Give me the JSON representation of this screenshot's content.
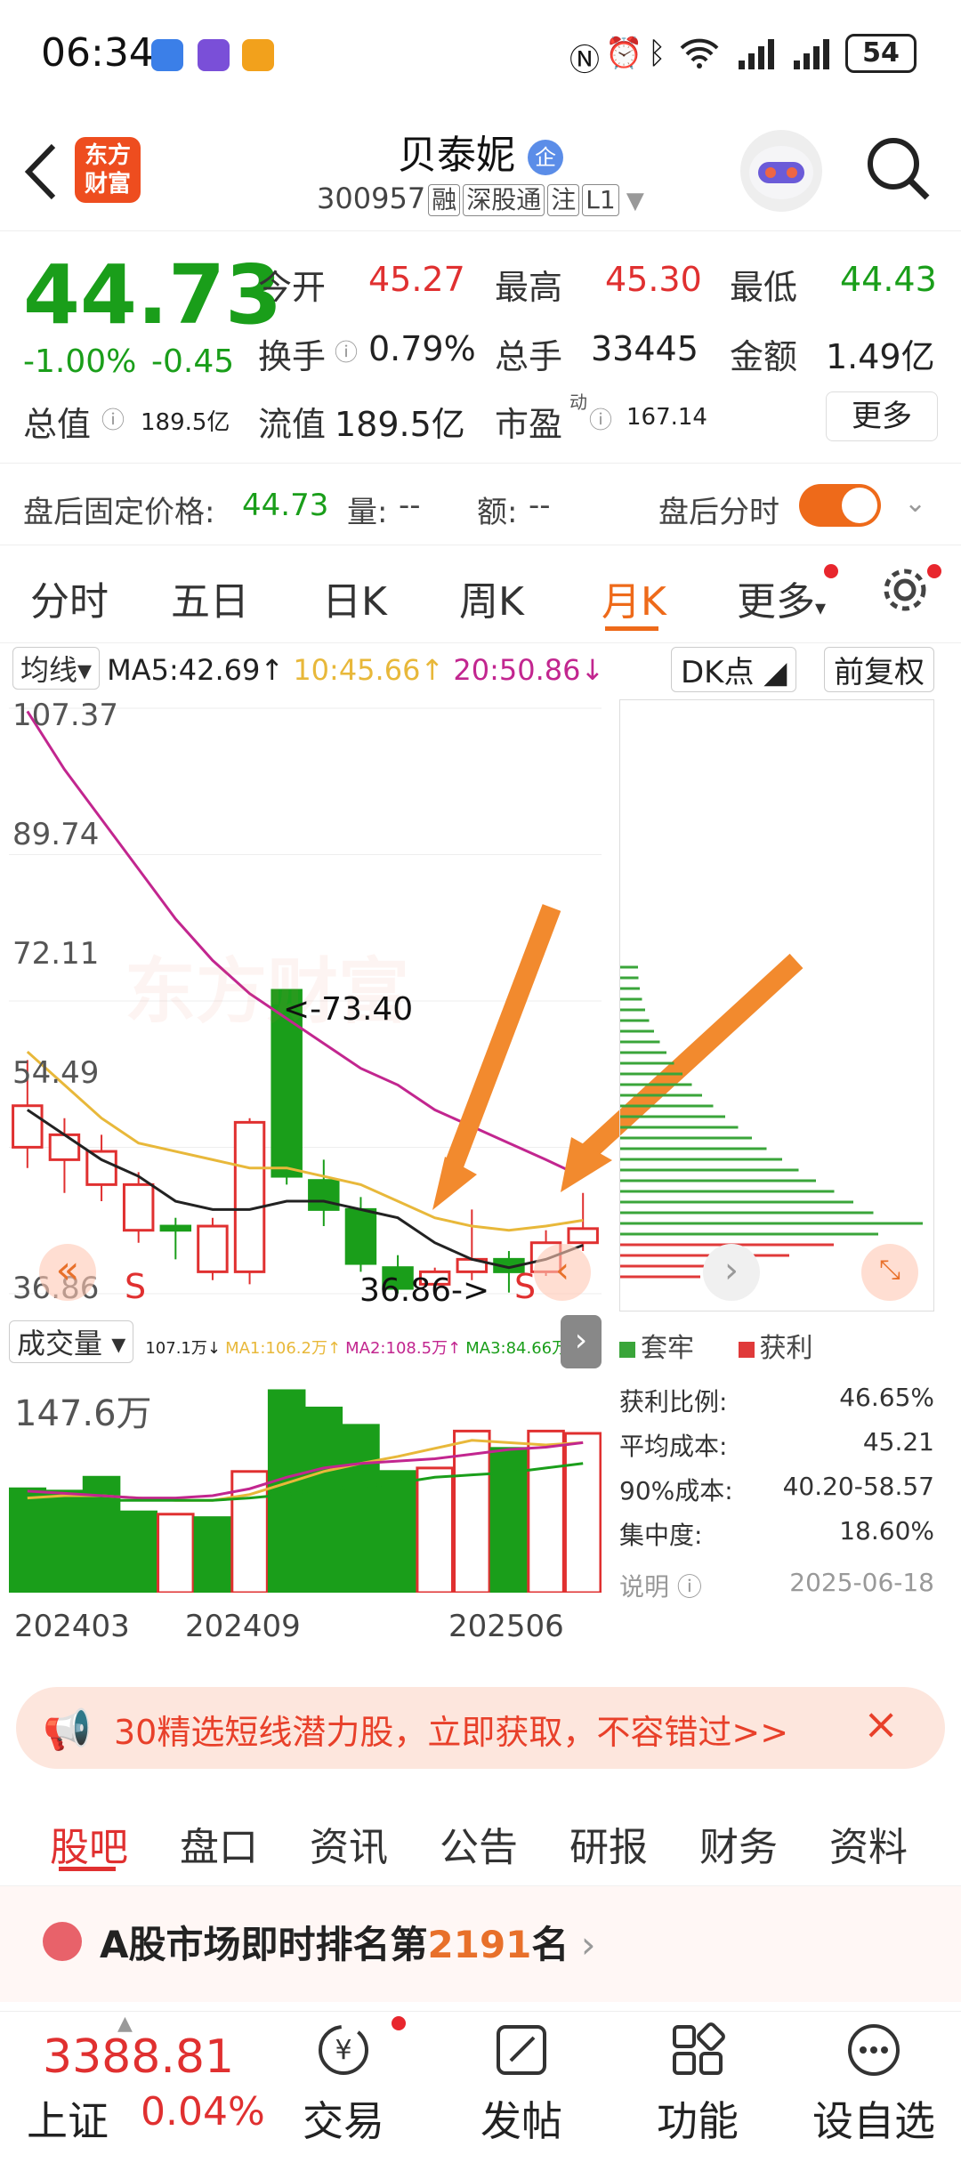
{
  "status": {
    "time": "06:34",
    "battery": "54"
  },
  "header": {
    "back_icon": "back-arrow-icon",
    "logo_text": "东方财富",
    "stock_name": "贝泰妮",
    "enterprise_badge": "企",
    "stock_code": "300957",
    "tags": [
      "融",
      "深股通",
      "注",
      "L1"
    ]
  },
  "quote": {
    "price": "44.73",
    "change_pct": "-1.00%",
    "change_amt": "-0.45",
    "open_label": "今开",
    "open": "45.27",
    "high_label": "最高",
    "high": "45.30",
    "low_label": "最低",
    "low": "44.43",
    "turnover_label": "换手",
    "turnover": "0.79%",
    "volume_label": "总手",
    "volume": "33445",
    "amount_label": "金额",
    "amount": "1.49亿",
    "mktcap_label": "总值",
    "mktcap": "189.5亿",
    "float_label": "流值",
    "float": "189.5亿",
    "pe_label": "市盈",
    "pe_super": "动",
    "pe": "167.14",
    "more_button": "更多"
  },
  "after_hours": {
    "label": "盘后固定价格:",
    "price": "44.73",
    "vol_label": "量:",
    "vol": "--",
    "amt_label": "额:",
    "amt": "--",
    "timeshare_label": "盘后分时"
  },
  "tabs": [
    "分时",
    "五日",
    "日K",
    "周K",
    "月K",
    "更多"
  ],
  "active_tab": "月K",
  "ma": {
    "selector": "均线",
    "ma5": "MA5:42.69",
    "ma10": "10:45.66",
    "ma20": "20:50.86",
    "dk_button": "DK点",
    "adjust_button": "前复权"
  },
  "chart_data": {
    "type": "candlestick",
    "y_labels": [
      "107.37",
      "89.74",
      "72.11",
      "54.49",
      "36.86"
    ],
    "ylim": [
      36.86,
      107.37
    ],
    "annotations": [
      "<-73.40",
      "36.86->"
    ],
    "signal_labels": [
      "S",
      "S"
    ],
    "candles": [
      {
        "o": 54.5,
        "c": 59.5,
        "h": 65.0,
        "l": 52.0
      },
      {
        "o": 53.0,
        "c": 56.0,
        "h": 58.0,
        "l": 49.0
      },
      {
        "o": 50.0,
        "c": 54.0,
        "h": 56.0,
        "l": 48.0
      },
      {
        "o": 44.5,
        "c": 50.0,
        "h": 51.5,
        "l": 43.0
      },
      {
        "o": 45.0,
        "c": 44.5,
        "h": 46.0,
        "l": 41.0
      },
      {
        "o": 39.5,
        "c": 45.0,
        "h": 46.0,
        "l": 38.5
      },
      {
        "o": 39.5,
        "c": 57.5,
        "h": 58.0,
        "l": 38.0
      },
      {
        "o": 73.4,
        "c": 51.0,
        "h": 73.5,
        "l": 50.0
      },
      {
        "o": 50.5,
        "c": 47.0,
        "h": 53.0,
        "l": 45.0
      },
      {
        "o": 47.0,
        "c": 40.5,
        "h": 48.5,
        "l": 39.5
      },
      {
        "o": 40.0,
        "c": 37.5,
        "h": 41.5,
        "l": 36.9
      },
      {
        "o": 38.0,
        "c": 39.5,
        "h": 40.0,
        "l": 37.5
      },
      {
        "o": 39.5,
        "c": 41.0,
        "h": 47.0,
        "l": 38.5
      },
      {
        "o": 41.0,
        "c": 39.5,
        "h": 42.0,
        "l": 37.0
      },
      {
        "o": 39.5,
        "c": 43.0,
        "h": 44.5,
        "l": 39.0
      },
      {
        "o": 43.0,
        "c": 44.7,
        "h": 49.0,
        "l": 42.0
      }
    ],
    "ma5": [
      59,
      56,
      53,
      51,
      48,
      47,
      47,
      48,
      48,
      47,
      46,
      43,
      41,
      40,
      41,
      42.7
    ],
    "ma10": [
      66,
      62,
      58,
      55,
      54,
      53,
      52,
      52,
      51,
      50,
      48,
      46,
      45,
      44.5,
      45,
      45.7
    ],
    "ma20": [
      107,
      100,
      94,
      88,
      82,
      77,
      73,
      70,
      67,
      64,
      62,
      59,
      57,
      55,
      53,
      50.9
    ]
  },
  "volume": {
    "selector": "成交量",
    "stats": [
      "107.1万↓",
      "MA1:106.2万↑",
      "MA2:108.5万↑",
      "MA3:84.66万↑"
    ],
    "max_label": "147.6万",
    "x_labels": [
      "202403",
      "202409",
      "202506"
    ],
    "bars": [
      90,
      88,
      100,
      70,
      68,
      65,
      105,
      175,
      160,
      145,
      105,
      108,
      140,
      125,
      140,
      138
    ],
    "bars_up": [
      false,
      false,
      false,
      false,
      true,
      false,
      true,
      false,
      false,
      false,
      false,
      true,
      true,
      false,
      true,
      true
    ]
  },
  "chip": {
    "legend_trapped": "套牢",
    "legend_profit": "获利",
    "profit_ratio_label": "获利比例:",
    "profit_ratio": "46.65%",
    "avg_cost_label": "平均成本:",
    "avg_cost": "45.21",
    "cost90_label": "90%成本:",
    "cost90": "40.20-58.57",
    "concentration_label": "集中度:",
    "concentration": "18.60%",
    "note_label": "说明",
    "date": "2025-06-18"
  },
  "banner": {
    "text": "30精选短线潜力股，立即获取，不容错过>>"
  },
  "bottom_tabs": [
    "股吧",
    "盘口",
    "资讯",
    "公告",
    "研报",
    "财务",
    "资料"
  ],
  "active_bottom_tab": "股吧",
  "rank": {
    "prefix": "A股市场即时排名第",
    "number": "2191",
    "suffix": "名"
  },
  "nav": {
    "index_value": "3388.81",
    "index_name": "上证",
    "index_change": "0.04%",
    "items": [
      "交易",
      "发帖",
      "功能",
      "设自选"
    ]
  },
  "colors": {
    "up": "#e03030",
    "down": "#1a9e1a",
    "accent": "#ee6a1a",
    "ma10": "#e8b83a",
    "ma20": "#c2268f"
  }
}
